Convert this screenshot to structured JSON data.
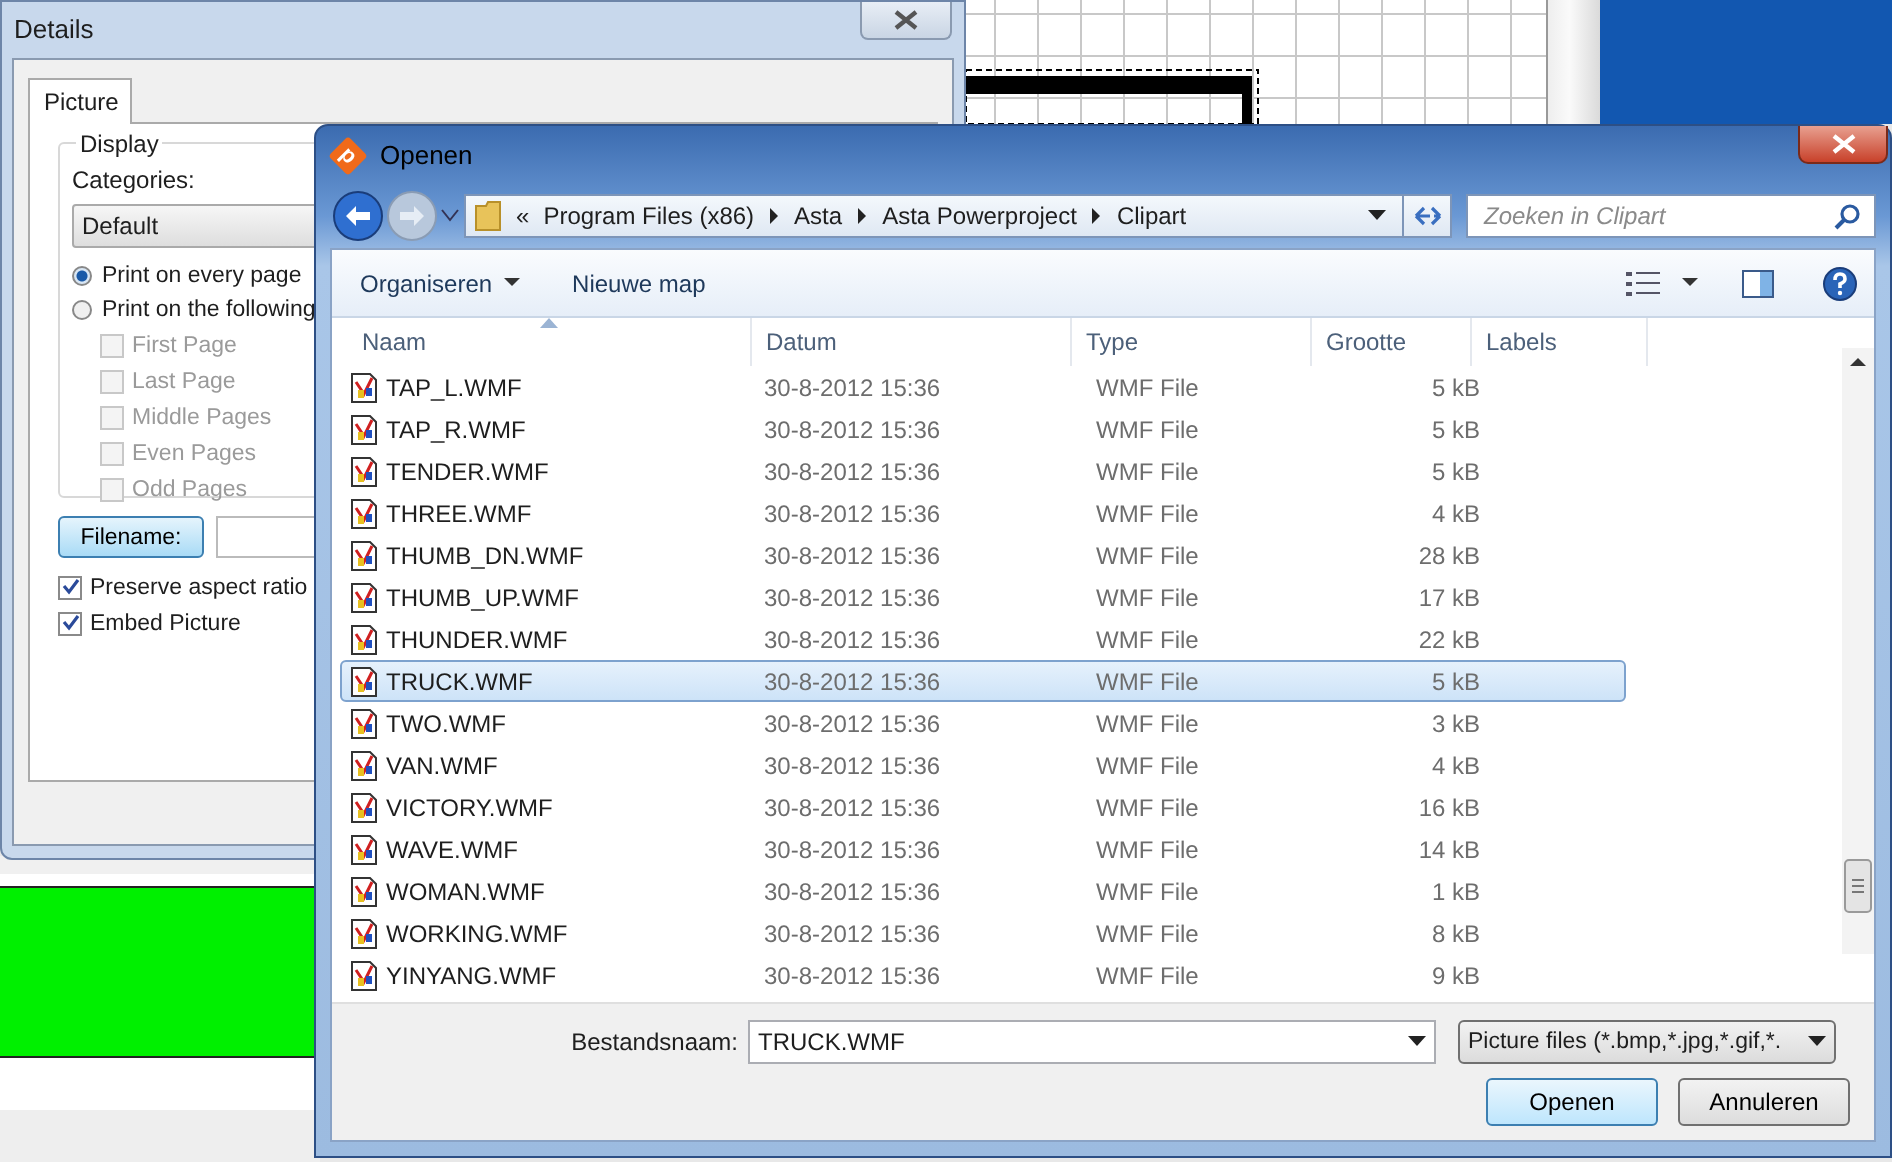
{
  "details_window": {
    "title": "Details",
    "tabs": [
      {
        "label": "Picture",
        "selected": true
      }
    ],
    "group_title": "Display",
    "categories_label": "Categories:",
    "category_value": "Default",
    "radios": [
      {
        "label": "Print on every page",
        "selected": true
      },
      {
        "label": "Print on the following",
        "selected": false
      }
    ],
    "pages": [
      {
        "label": "First Page",
        "checked": false,
        "disabled": true
      },
      {
        "label": "Last Page",
        "checked": false,
        "disabled": true
      },
      {
        "label": "Middle Pages",
        "checked": false,
        "disabled": true
      },
      {
        "label": "Even Pages",
        "checked": false,
        "disabled": true
      },
      {
        "label": "Odd Pages",
        "checked": false,
        "disabled": true
      }
    ],
    "filename_button": "Filename:",
    "options": [
      {
        "label": "Preserve aspect ratio",
        "checked": true
      },
      {
        "label": "Embed Picture",
        "checked": true
      }
    ]
  },
  "open_dialog": {
    "logo": "p",
    "title": "Openen",
    "path_overflow": "«",
    "path": [
      "Program Files (x86)",
      "Asta",
      "Asta Powerproject",
      "Clipart"
    ],
    "search_placeholder": "Zoeken in Clipart",
    "toolbar": [
      "Organiseren",
      "Nieuwe map"
    ],
    "columns": [
      "Naam",
      "Datum",
      "Type",
      "Grootte",
      "Labels"
    ],
    "rows": [
      {
        "name": "TAP_L.WMF",
        "date": "30-8-2012 15:36",
        "type": "WMF File",
        "size": "5 kB",
        "selected": false
      },
      {
        "name": "TAP_R.WMF",
        "date": "30-8-2012 15:36",
        "type": "WMF File",
        "size": "5 kB",
        "selected": false
      },
      {
        "name": "TENDER.WMF",
        "date": "30-8-2012 15:36",
        "type": "WMF File",
        "size": "5 kB",
        "selected": false
      },
      {
        "name": "THREE.WMF",
        "date": "30-8-2012 15:36",
        "type": "WMF File",
        "size": "4 kB",
        "selected": false
      },
      {
        "name": "THUMB_DN.WMF",
        "date": "30-8-2012 15:36",
        "type": "WMF File",
        "size": "28 kB",
        "selected": false
      },
      {
        "name": "THUMB_UP.WMF",
        "date": "30-8-2012 15:36",
        "type": "WMF File",
        "size": "17 kB",
        "selected": false
      },
      {
        "name": "THUNDER.WMF",
        "date": "30-8-2012 15:36",
        "type": "WMF File",
        "size": "22 kB",
        "selected": false
      },
      {
        "name": "TRUCK.WMF",
        "date": "30-8-2012 15:36",
        "type": "WMF File",
        "size": "5 kB",
        "selected": true
      },
      {
        "name": "TWO.WMF",
        "date": "30-8-2012 15:36",
        "type": "WMF File",
        "size": "3 kB",
        "selected": false
      },
      {
        "name": "VAN.WMF",
        "date": "30-8-2012 15:36",
        "type": "WMF File",
        "size": "4 kB",
        "selected": false
      },
      {
        "name": "VICTORY.WMF",
        "date": "30-8-2012 15:36",
        "type": "WMF File",
        "size": "16 kB",
        "selected": false
      },
      {
        "name": "WAVE.WMF",
        "date": "30-8-2012 15:36",
        "type": "WMF File",
        "size": "14 kB",
        "selected": false
      },
      {
        "name": "WOMAN.WMF",
        "date": "30-8-2012 15:36",
        "type": "WMF File",
        "size": "1 kB",
        "selected": false
      },
      {
        "name": "WORKING.WMF",
        "date": "30-8-2012 15:36",
        "type": "WMF File",
        "size": "8 kB",
        "selected": false
      },
      {
        "name": "YINYANG.WMF",
        "date": "30-8-2012 15:36",
        "type": "WMF File",
        "size": "9 kB",
        "selected": false
      }
    ],
    "filename_label": "Bestandsnaam:",
    "filename_value": "TRUCK.WMF",
    "filter": "Picture files (*.bmp,*.jpg,*.gif,*.",
    "buttons": [
      "Openen",
      "Annuleren"
    ]
  }
}
